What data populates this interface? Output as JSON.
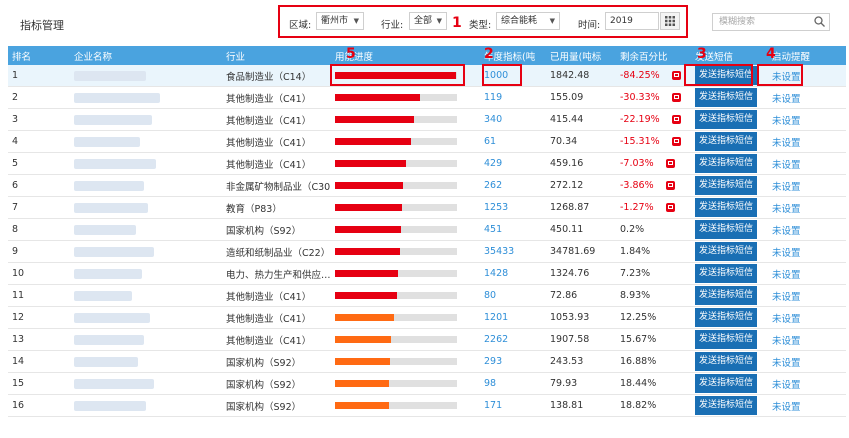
{
  "page_title": "指标管理",
  "filters": {
    "region_label": "区域:",
    "region_value": "衢州市",
    "industry_label": "行业:",
    "industry_value": "全部",
    "type_label": "类型:",
    "type_value": "综合能耗",
    "time_label": "时间:",
    "time_value": "2019"
  },
  "search": {
    "placeholder": "模糊搜索"
  },
  "markers": {
    "m1": "1",
    "m2": "2",
    "m3": "3",
    "m4": "4",
    "m5": "5"
  },
  "table": {
    "headers": [
      "排名",
      "企业名称",
      "行业",
      "用能进度",
      "年度指标(吨",
      "已用量(吨标",
      "剩余百分比",
      "发送短信",
      "启动提醒"
    ],
    "rows": [
      {
        "rank": "1",
        "industry": "食品制造业（C14）",
        "progress": 0.99,
        "color": "#e60012",
        "quota": "1000",
        "used": "1842.48",
        "remain": "-84.25%",
        "neg": true,
        "send": "发送指标短信",
        "remind": "未设置"
      },
      {
        "rank": "2",
        "industry": "其他制造业（C41）",
        "progress": 0.7,
        "color": "#e60012",
        "quota": "119",
        "used": "155.09",
        "remain": "-30.33%",
        "neg": true,
        "send": "发送指标短信",
        "remind": "未设置"
      },
      {
        "rank": "3",
        "industry": "其他制造业（C41）",
        "progress": 0.65,
        "color": "#e60012",
        "quota": "340",
        "used": "415.44",
        "remain": "-22.19%",
        "neg": true,
        "send": "发送指标短信",
        "remind": "未设置"
      },
      {
        "rank": "4",
        "industry": "其他制造业（C41）",
        "progress": 0.62,
        "color": "#e60012",
        "quota": "61",
        "used": "70.34",
        "remain": "-15.31%",
        "neg": true,
        "send": "发送指标短信",
        "remind": "未设置"
      },
      {
        "rank": "5",
        "industry": "其他制造业（C41）",
        "progress": 0.58,
        "color": "#e60012",
        "quota": "429",
        "used": "459.16",
        "remain": "-7.03%",
        "neg": true,
        "send": "发送指标短信",
        "remind": "未设置"
      },
      {
        "rank": "6",
        "industry": "非金属矿物制品业（C30…",
        "progress": 0.56,
        "color": "#e60012",
        "quota": "262",
        "used": "272.12",
        "remain": "-3.86%",
        "neg": true,
        "send": "发送指标短信",
        "remind": "未设置"
      },
      {
        "rank": "7",
        "industry": "教育（P83）",
        "progress": 0.55,
        "color": "#e60012",
        "quota": "1253",
        "used": "1268.87",
        "remain": "-1.27%",
        "neg": true,
        "send": "发送指标短信",
        "remind": "未设置"
      },
      {
        "rank": "8",
        "industry": "国家机构（S92）",
        "progress": 0.54,
        "color": "#e60012",
        "quota": "451",
        "used": "450.11",
        "remain": "0.2%",
        "neg": false,
        "send": "发送指标短信",
        "remind": "未设置"
      },
      {
        "rank": "9",
        "industry": "造纸和纸制品业（C22）",
        "progress": 0.53,
        "color": "#e60012",
        "quota": "35433",
        "used": "34781.69",
        "remain": "1.84%",
        "neg": false,
        "send": "发送指标短信",
        "remind": "未设置"
      },
      {
        "rank": "10",
        "industry": "电力、热力生产和供应…",
        "progress": 0.52,
        "color": "#e60012",
        "quota": "1428",
        "used": "1324.76",
        "remain": "7.23%",
        "neg": false,
        "send": "发送指标短信",
        "remind": "未设置"
      },
      {
        "rank": "11",
        "industry": "其他制造业（C41）",
        "progress": 0.51,
        "color": "#e60012",
        "quota": "80",
        "used": "72.86",
        "remain": "8.93%",
        "neg": false,
        "send": "发送指标短信",
        "remind": "未设置"
      },
      {
        "rank": "12",
        "industry": "其他制造业（C41）",
        "progress": 0.48,
        "color": "#ff6a13",
        "quota": "1201",
        "used": "1053.93",
        "remain": "12.25%",
        "neg": false,
        "send": "发送指标短信",
        "remind": "未设置"
      },
      {
        "rank": "13",
        "industry": "其他制造业（C41）",
        "progress": 0.46,
        "color": "#ff6a13",
        "quota": "2262",
        "used": "1907.58",
        "remain": "15.67%",
        "neg": false,
        "send": "发送指标短信",
        "remind": "未设置"
      },
      {
        "rank": "14",
        "industry": "国家机构（S92）",
        "progress": 0.45,
        "color": "#ff6a13",
        "quota": "293",
        "used": "243.53",
        "remain": "16.88%",
        "neg": false,
        "send": "发送指标短信",
        "remind": "未设置"
      },
      {
        "rank": "15",
        "industry": "国家机构（S92）",
        "progress": 0.44,
        "color": "#ff6a13",
        "quota": "98",
        "used": "79.93",
        "remain": "18.44%",
        "neg": false,
        "send": "发送指标短信",
        "remind": "未设置"
      },
      {
        "rank": "16",
        "industry": "国家机构（S92）",
        "progress": 0.44,
        "color": "#ff6a13",
        "quota": "171",
        "used": "138.81",
        "remain": "18.82%",
        "neg": false,
        "send": "发送指标短信",
        "remind": "未设置"
      }
    ]
  }
}
